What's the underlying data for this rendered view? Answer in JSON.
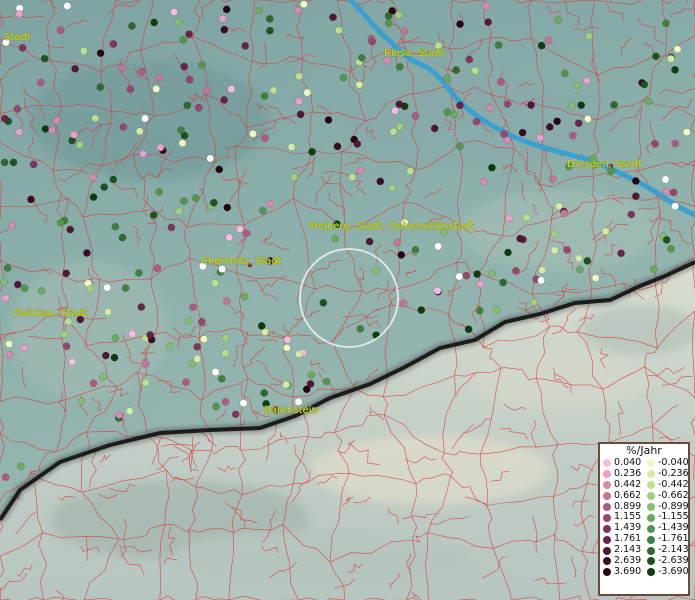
{
  "map": {
    "place_labels": [
      "Stadt",
      "Riesa, Stadt",
      "Dresden, Stadt",
      "Freiberg, Stadt, Universitätsstadt",
      "Chemnitz, Stadt",
      "Zwickau, Stadt",
      "Bärenstein"
    ],
    "colors": {
      "border_lines": "#d83a3a",
      "river": "#3aa0d0",
      "terrain_low": "#7fa6a4",
      "terrain_high": "#c9d2cc",
      "national_border": "#1c1c1c",
      "highlight_circle": "#f4f4f4",
      "label_text": "#d4e000"
    }
  },
  "legend": {
    "title": "%/Jahr",
    "positive": {
      "values": [
        "0.040",
        "0.236",
        "0.442",
        "0.662",
        "0.899",
        "1.155",
        "1.439",
        "1.761",
        "2.143",
        "2.639",
        "3.690"
      ],
      "colors": [
        "#f7bde0",
        "#e9a1c8",
        "#d98aaf",
        "#c6749a",
        "#b05a82",
        "#98466e",
        "#80345a",
        "#682348",
        "#521636",
        "#3c0c24",
        "#280412"
      ]
    },
    "negative": {
      "values": [
        "-0.040",
        "-0.236",
        "-0.442",
        "-0.662",
        "-0.899",
        "-1.155",
        "-1.439",
        "-1.761",
        "-2.143",
        "-2.639",
        "-3.690"
      ],
      "colors": [
        "#f1f7bf",
        "#d6eca6",
        "#bde090",
        "#a2d080",
        "#86bd70",
        "#6caa60",
        "#549550",
        "#3f8040",
        "#2d6a30",
        "#1c5420",
        "#0e3c10"
      ]
    }
  }
}
